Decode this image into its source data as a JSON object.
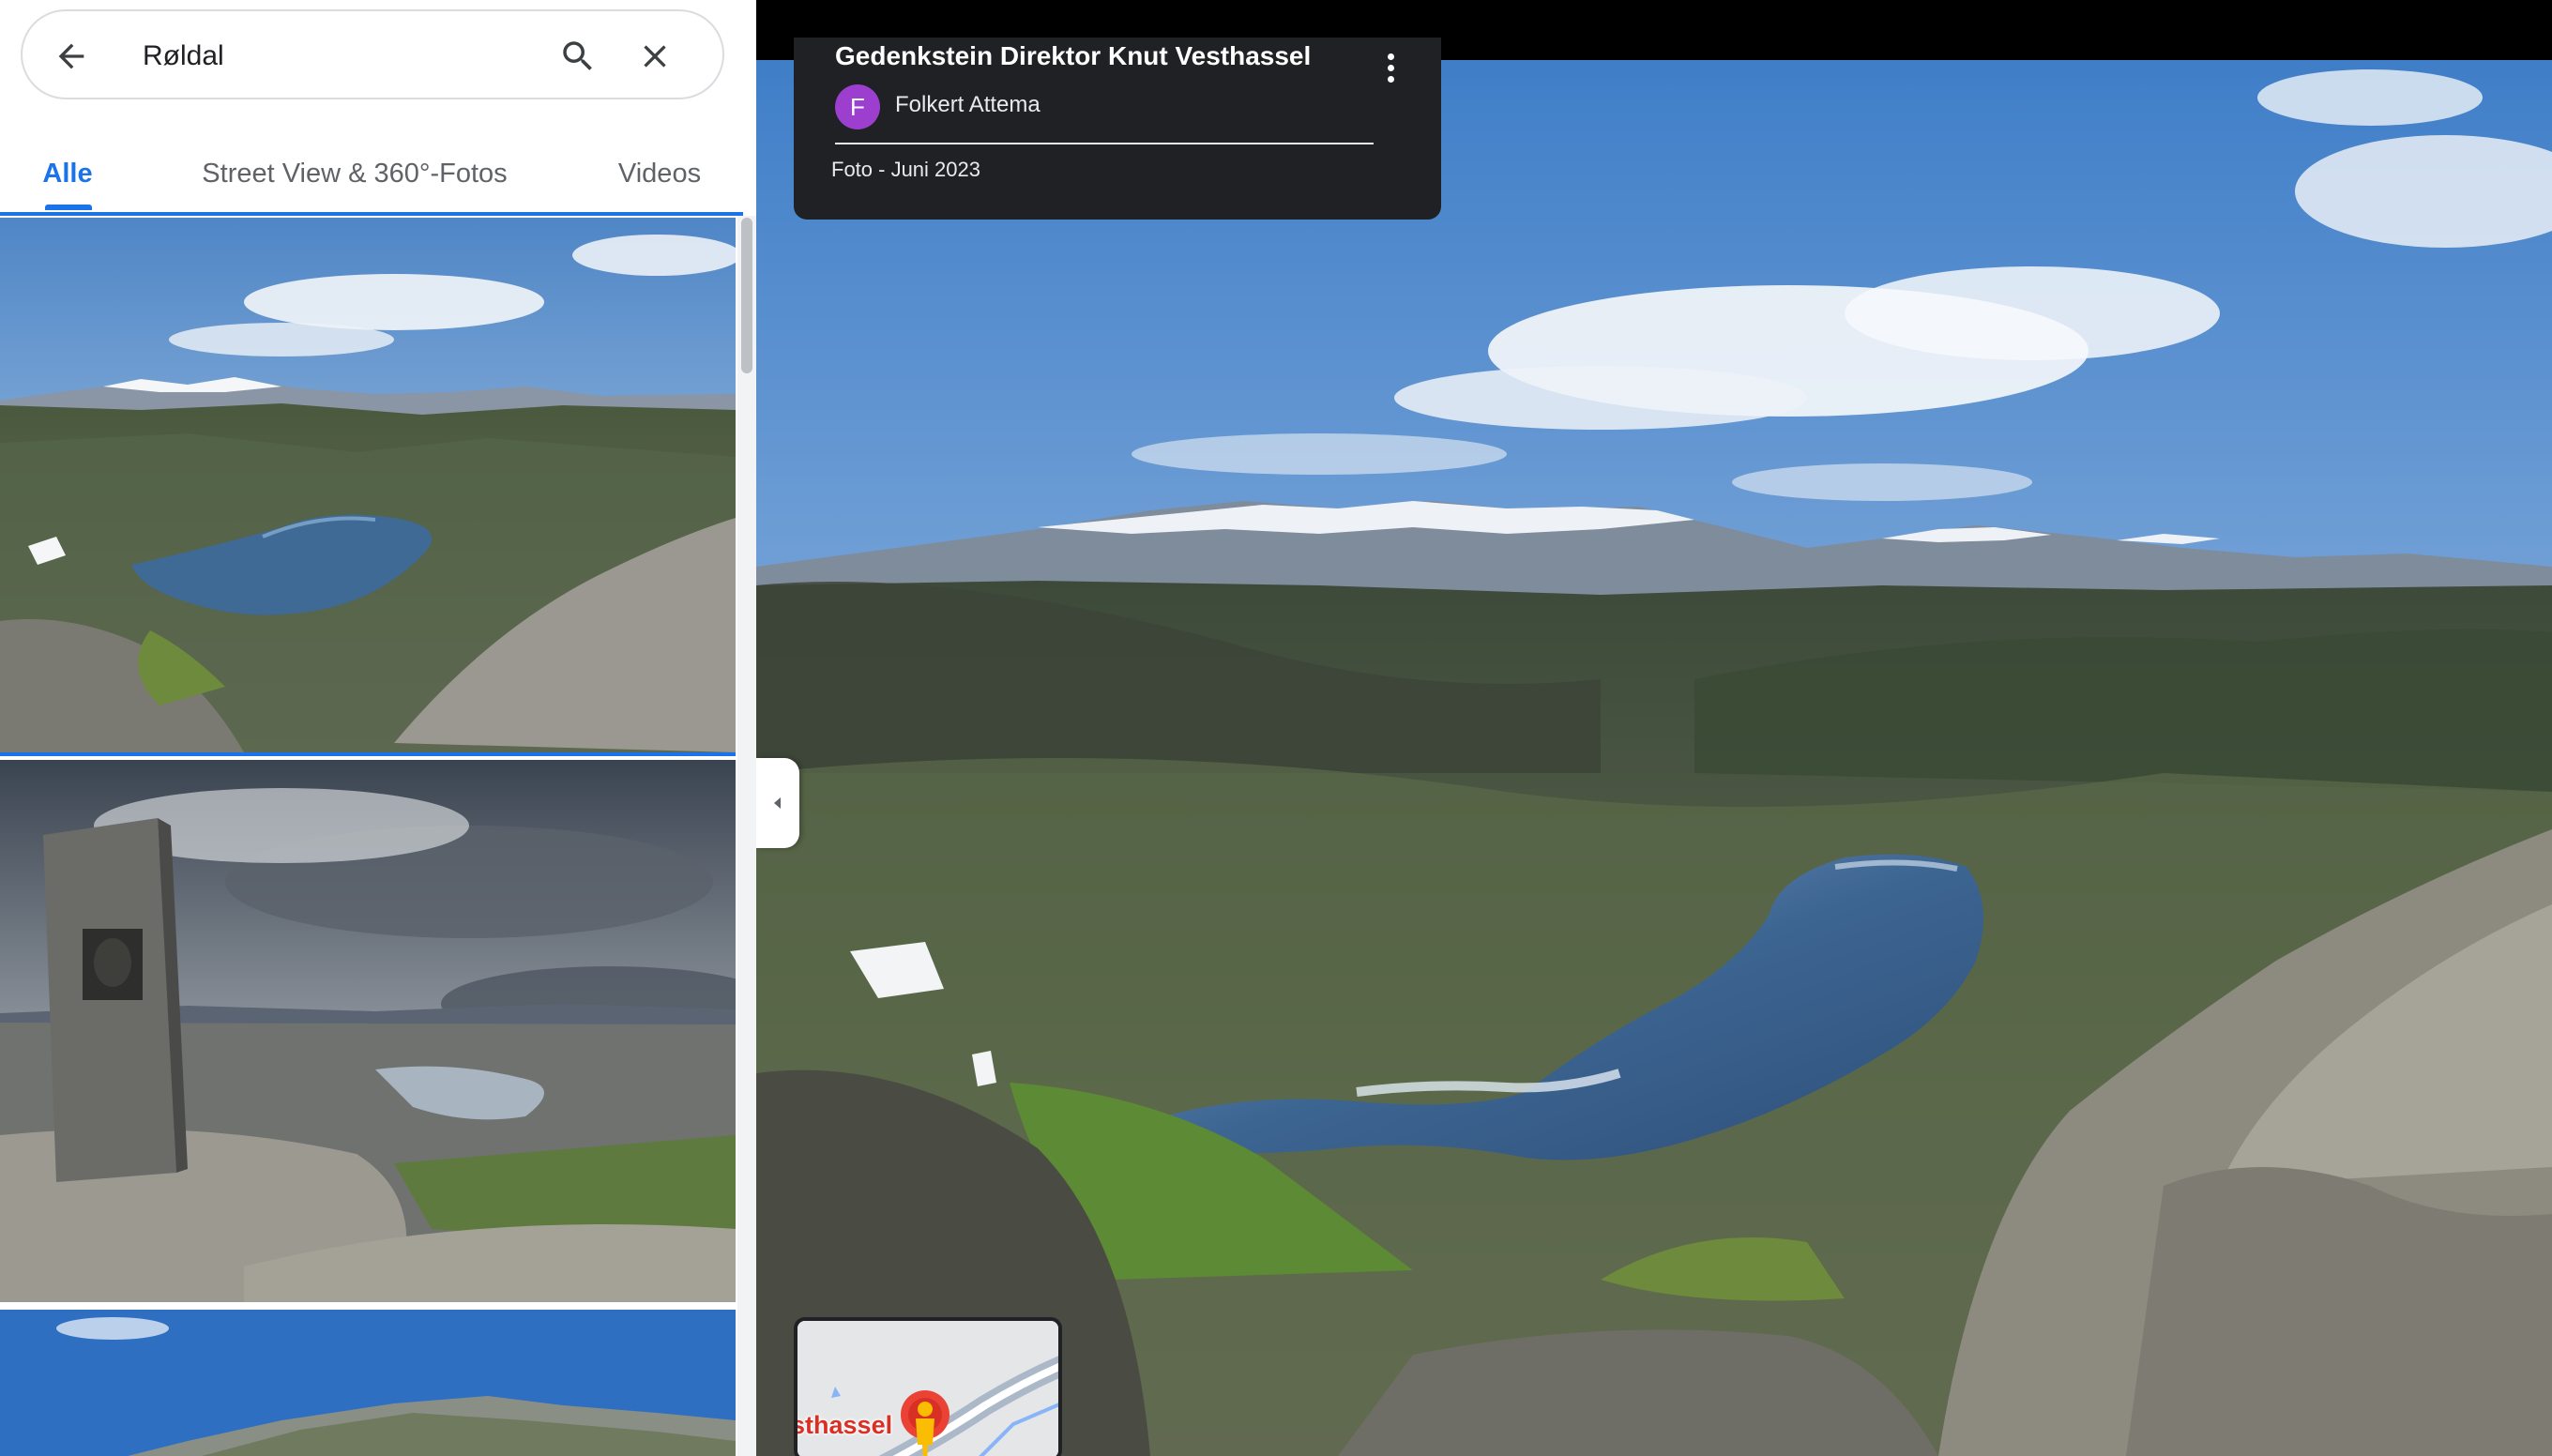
{
  "search": {
    "value": "Røldal"
  },
  "tabs": [
    {
      "label": "Alle",
      "active": true
    },
    {
      "label": "Street View & 360°-Fotos",
      "active": false
    },
    {
      "label": "Videos",
      "active": false
    }
  ],
  "info_card": {
    "title": "Gedenkstein Direktor Knut Vesthassel",
    "author_initial": "F",
    "author_name": "Folkert Attema",
    "date": "Foto - Juni 2023"
  },
  "minimap": {
    "label": "esthassel"
  },
  "colors": {
    "accent": "#1a73e8",
    "avatar": "#9c3fcf",
    "card_bg": "#202124",
    "map_pin": "#ea4335"
  },
  "icons": [
    "back-arrow-icon",
    "search-icon",
    "close-icon",
    "more-vert-icon",
    "chevron-left-icon",
    "pegman-icon",
    "map-pin-icon"
  ]
}
